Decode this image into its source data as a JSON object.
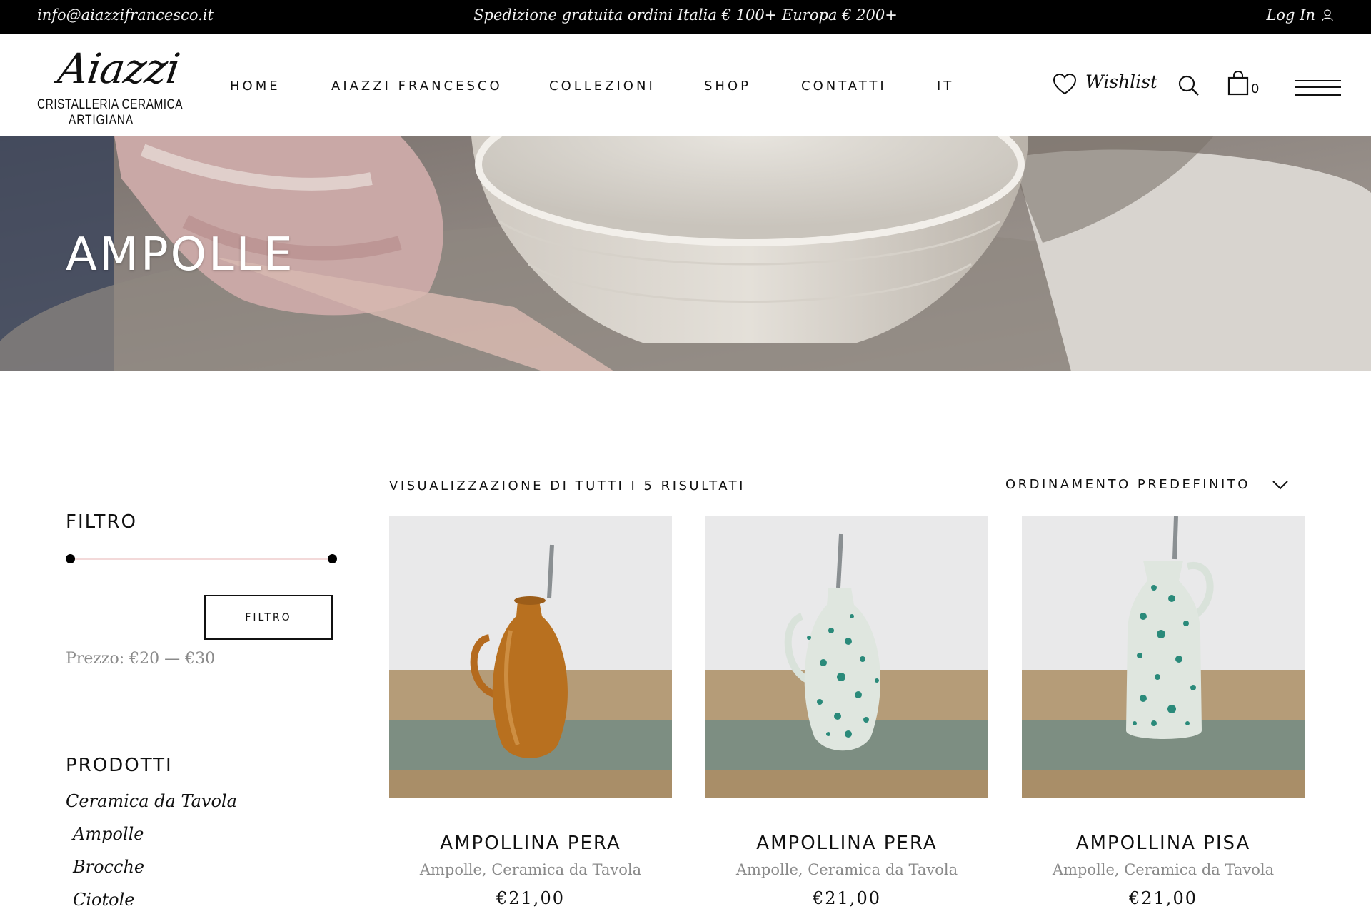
{
  "topbar": {
    "email": "info@aiazzifrancesco.it",
    "promo": "Spedizione gratuita ordini Italia € 100+ Europa € 200+",
    "login_label": "Log In"
  },
  "header": {
    "logo": {
      "script": "Aiazzi",
      "line1": "CRISTALLERIA CERAMICA",
      "line2": "ARTIGIANA"
    },
    "nav": [
      "HOME",
      "AIAZZI FRANCESCO",
      "COLLEZIONI",
      "SHOP",
      "CONTATTI",
      "IT"
    ],
    "wishlist_label": "Wishlist",
    "cart_count": "0"
  },
  "hero": {
    "title": "AMPOLLE"
  },
  "sidebar": {
    "filter_title": "FILTRO",
    "price_range": {
      "min_fraction": 0,
      "max_fraction": 1
    },
    "filter_button": "FILTRO",
    "price_label": "Prezzo: €20 — €30",
    "products_title": "PRODOTTI",
    "categories": [
      {
        "label": "Ceramica da Tavola",
        "sub": false
      },
      {
        "label": "Ampolle",
        "sub": true
      },
      {
        "label": "Brocche",
        "sub": true
      },
      {
        "label": "Ciotole",
        "sub": true
      }
    ]
  },
  "toolbar": {
    "results_text": "VISUALIZZAZIONE DI TUTTI I 5 RISULTATI",
    "sort_label": "ORDINAMENTO PREDEFINITO"
  },
  "products": [
    {
      "name": "AMPOLLINA PERA",
      "categories": "Ampolle, Ceramica da Tavola",
      "price": "€21,00",
      "glaze": "amber"
    },
    {
      "name": "AMPOLLINA PERA",
      "categories": "Ampolle, Ceramica da Tavola",
      "price": "€21,00",
      "glaze": "green-speckled"
    },
    {
      "name": "AMPOLLINA PISA",
      "categories": "Ampolle, Ceramica da Tavola",
      "price": "€21,00",
      "glaze": "green-speckled"
    }
  ],
  "colors": {
    "topbar_bg": "#000000",
    "slider_track": "#f3d9d9",
    "muted_text": "#8a8a8a"
  }
}
